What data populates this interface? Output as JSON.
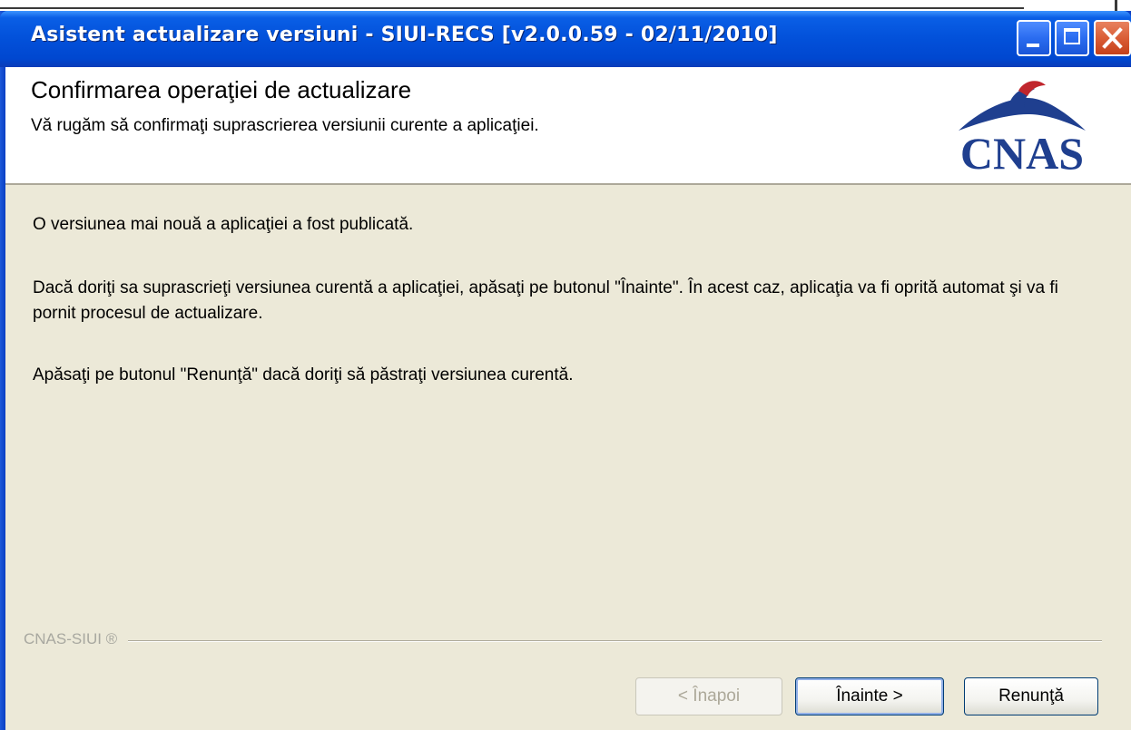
{
  "window": {
    "title": "Asistent actualizare versiuni - SIUI-RECS [v2.0.0.59 - 02/11/2010]"
  },
  "header": {
    "title": "Confirmarea operaţiei de actualizare",
    "subtitle": "Vă rugăm să confirmaţi suprascrierea versiunii curente a aplicaţiei.",
    "logo_text": "CNAS"
  },
  "content": {
    "paragraph1": "O versiunea mai nouă a aplicaţiei a fost publicată.",
    "paragraph2": "Dacă doriţi sa suprascrieţi versiunea curentă a aplicaţiei, apăsaţi pe butonul \"Înainte\". În acest caz, aplicaţia va fi oprită automat şi va fi pornit procesul de actualizare.",
    "paragraph3": "Apăsaţi pe butonul \"Renunţă\" dacă doriţi să păstraţi versiunea curentă."
  },
  "footer": {
    "brand_label": "CNAS-SIUI ®",
    "back_label": "< Înapoi",
    "next_label": "Înainte >",
    "cancel_label": "Renunţă"
  },
  "colors": {
    "titlebar": "#0352db",
    "dialog_bg": "#ece9d8",
    "logo_blue": "#1f3f8f",
    "logo_red": "#c0262d"
  },
  "icons": {
    "minimize": "minimize-icon",
    "maximize": "maximize-icon",
    "close": "close-icon"
  }
}
